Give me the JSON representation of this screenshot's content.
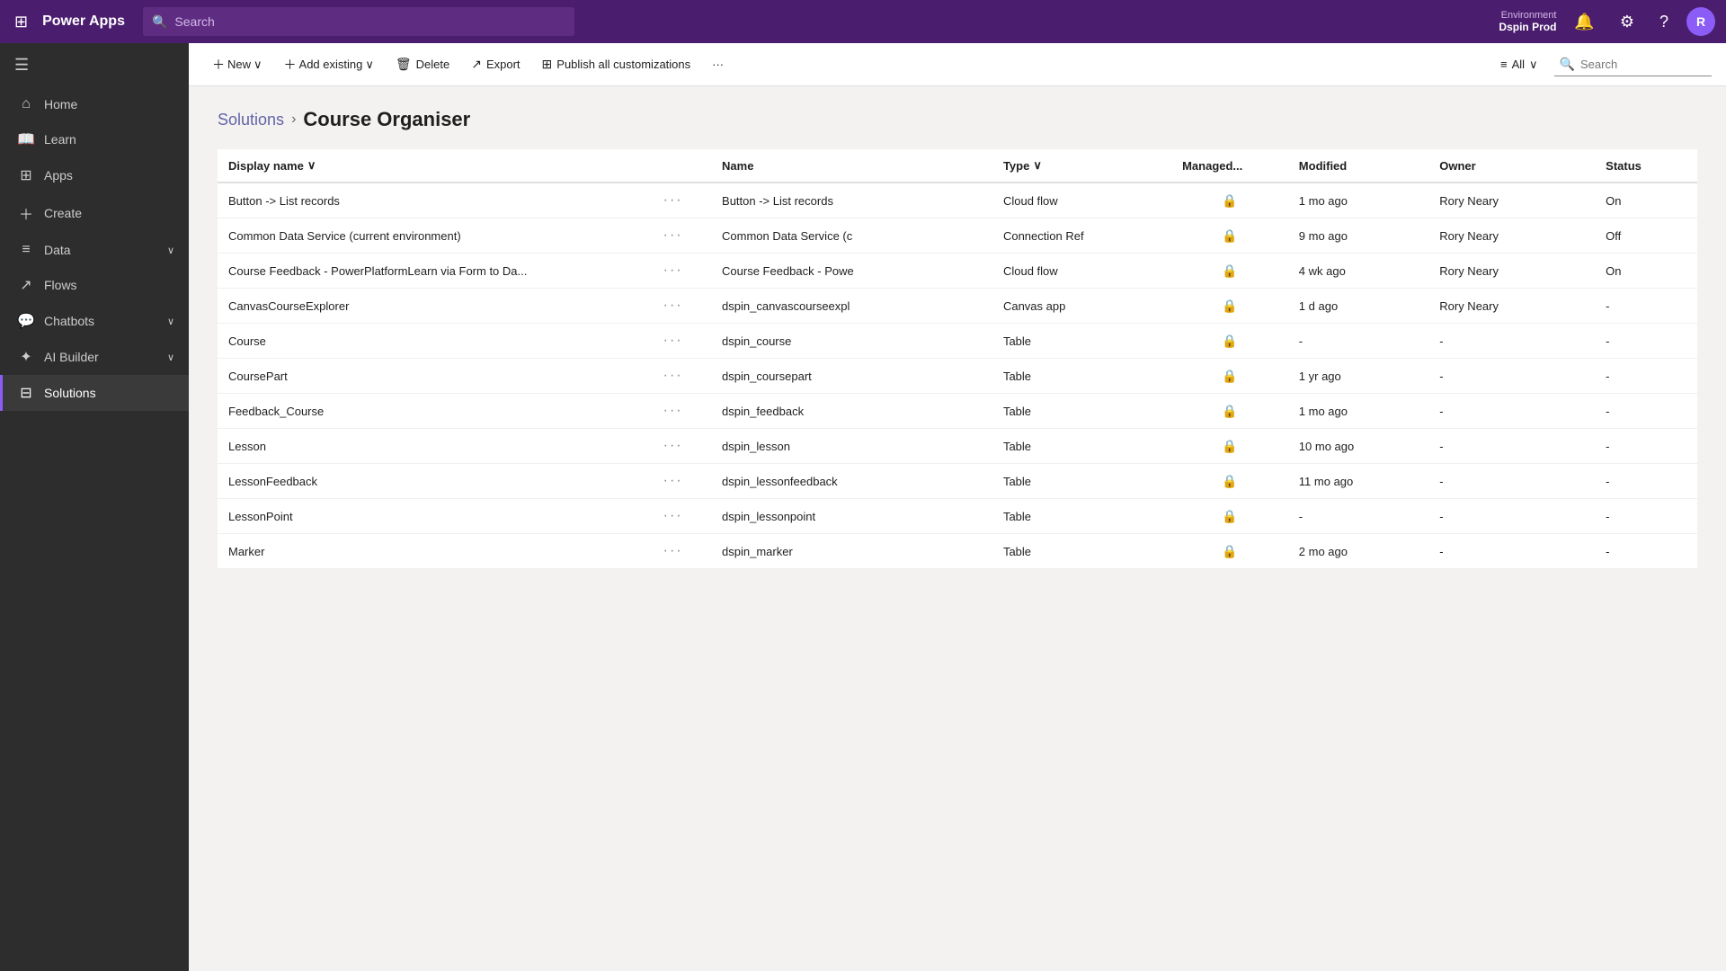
{
  "topNav": {
    "brand": "Power Apps",
    "searchPlaceholder": "Search",
    "environment": {
      "label": "Environment",
      "name": "Dspin Prod"
    },
    "avatarInitial": "R"
  },
  "sidebar": {
    "toggleLabel": "Collapse",
    "items": [
      {
        "id": "home",
        "label": "Home",
        "icon": "⌂",
        "active": false
      },
      {
        "id": "learn",
        "label": "Learn",
        "icon": "📖",
        "active": false
      },
      {
        "id": "apps",
        "label": "Apps",
        "icon": "⊞",
        "active": false
      },
      {
        "id": "create",
        "label": "Create",
        "icon": "+",
        "active": false
      },
      {
        "id": "data",
        "label": "Data",
        "icon": "≡",
        "active": false,
        "hasChevron": true
      },
      {
        "id": "flows",
        "label": "Flows",
        "icon": "↗",
        "active": false
      },
      {
        "id": "chatbots",
        "label": "Chatbots",
        "icon": "💬",
        "active": false,
        "hasChevron": true
      },
      {
        "id": "ai-builder",
        "label": "AI Builder",
        "icon": "✦",
        "active": false,
        "hasChevron": true
      },
      {
        "id": "solutions",
        "label": "Solutions",
        "icon": "⊟",
        "active": true
      }
    ]
  },
  "commandBar": {
    "buttons": [
      {
        "id": "new",
        "label": "New",
        "icon": "+",
        "hasChevron": true
      },
      {
        "id": "add-existing",
        "label": "Add existing",
        "icon": "+",
        "hasChevron": true
      },
      {
        "id": "delete",
        "label": "Delete",
        "icon": "🗑"
      },
      {
        "id": "export",
        "label": "Export",
        "icon": "↗"
      },
      {
        "id": "publish-all",
        "label": "Publish all customizations",
        "icon": "⊞"
      },
      {
        "id": "more",
        "label": "···"
      }
    ],
    "filterLabel": "All",
    "searchPlaceholder": "Search"
  },
  "breadcrumb": {
    "parent": "Solutions",
    "current": "Course Organiser"
  },
  "table": {
    "columns": [
      {
        "id": "display-name",
        "label": "Display name",
        "sortable": true
      },
      {
        "id": "more",
        "label": ""
      },
      {
        "id": "name",
        "label": "Name"
      },
      {
        "id": "type",
        "label": "Type",
        "sortable": true
      },
      {
        "id": "managed",
        "label": "Managed..."
      },
      {
        "id": "modified",
        "label": "Modified"
      },
      {
        "id": "owner",
        "label": "Owner"
      },
      {
        "id": "status",
        "label": "Status"
      }
    ],
    "rows": [
      {
        "displayName": "Button -> List records",
        "name": "Button -> List records",
        "type": "Cloud flow",
        "managed": true,
        "modified": "1 mo ago",
        "owner": "Rory Neary",
        "status": "On",
        "statusClass": "status-on"
      },
      {
        "displayName": "Common Data Service (current environment)",
        "name": "Common Data Service (c",
        "type": "Connection Ref",
        "managed": true,
        "modified": "9 mo ago",
        "owner": "Rory Neary",
        "status": "Off",
        "statusClass": "status-off"
      },
      {
        "displayName": "Course Feedback - PowerPlatformLearn via Form to Da...",
        "name": "Course Feedback - Powe",
        "type": "Cloud flow",
        "managed": true,
        "modified": "4 wk ago",
        "owner": "Rory Neary",
        "status": "On",
        "statusClass": "status-on"
      },
      {
        "displayName": "CanvasCourseExplorer",
        "name": "dspin_canvascourseexpl",
        "type": "Canvas app",
        "managed": true,
        "modified": "1 d ago",
        "owner": "Rory Neary",
        "status": "-",
        "statusClass": "status-dash"
      },
      {
        "displayName": "Course",
        "name": "dspin_course",
        "type": "Table",
        "managed": true,
        "modified": "-",
        "owner": "-",
        "status": "-",
        "statusClass": "status-dash"
      },
      {
        "displayName": "CoursePart",
        "name": "dspin_coursepart",
        "type": "Table",
        "managed": true,
        "modified": "1 yr ago",
        "owner": "-",
        "status": "-",
        "statusClass": "status-dash"
      },
      {
        "displayName": "Feedback_Course",
        "name": "dspin_feedback",
        "type": "Table",
        "managed": true,
        "modified": "1 mo ago",
        "owner": "-",
        "status": "-",
        "statusClass": "status-dash"
      },
      {
        "displayName": "Lesson",
        "name": "dspin_lesson",
        "type": "Table",
        "managed": true,
        "modified": "10 mo ago",
        "owner": "-",
        "status": "-",
        "statusClass": "status-dash"
      },
      {
        "displayName": "LessonFeedback",
        "name": "dspin_lessonfeedback",
        "type": "Table",
        "managed": true,
        "modified": "11 mo ago",
        "owner": "-",
        "status": "-",
        "statusClass": "status-dash"
      },
      {
        "displayName": "LessonPoint",
        "name": "dspin_lessonpoint",
        "type": "Table",
        "managed": true,
        "modified": "-",
        "owner": "-",
        "status": "-",
        "statusClass": "status-dash"
      },
      {
        "displayName": "Marker",
        "name": "dspin_marker",
        "type": "Table",
        "managed": true,
        "modified": "2 mo ago",
        "owner": "-",
        "status": "-",
        "statusClass": "status-dash"
      }
    ]
  }
}
